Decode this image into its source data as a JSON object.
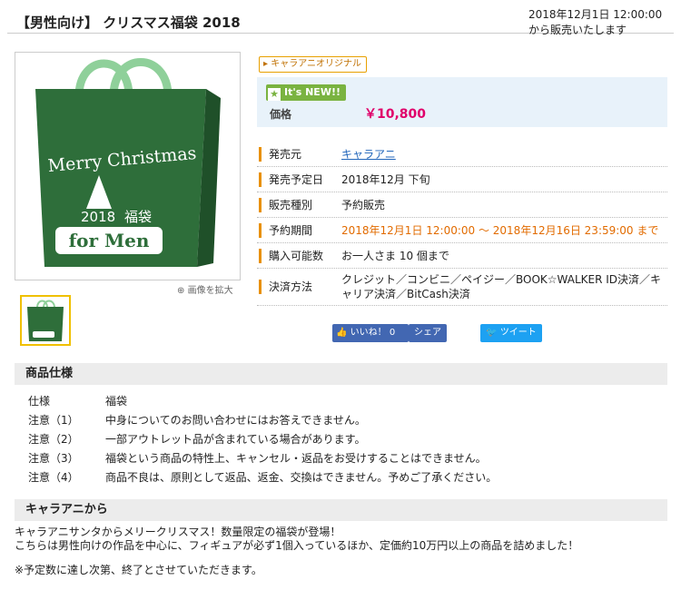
{
  "header": {
    "title": "【男性向け】 クリスマス福袋 2018",
    "release_line1": "2018年12月1日 12:00:00",
    "release_line2": "から販売いたします"
  },
  "image": {
    "bag_text1": "Merry Christmas",
    "bag_year": "2018",
    "bag_kanji": "福袋",
    "bag_label": "for Men",
    "zoom_label": "画像を拡大"
  },
  "badges": {
    "original": "キャラアニオリジナル",
    "new": "It's NEW!!"
  },
  "price": {
    "label": "価格",
    "value": "￥10,800"
  },
  "specs": [
    {
      "label": "発売元",
      "value": "キャラアニ"
    },
    {
      "label": "発売予定日",
      "value": "2018年12月 下旬"
    },
    {
      "label": "販売種別",
      "value": "予約販売"
    },
    {
      "label": "予約期間",
      "value": "2018年12月1日 12:00:00 ～ 2018年12月16日 23:59:00 まで"
    },
    {
      "label": "購入可能数",
      "value": "お一人さま 10 個まで"
    },
    {
      "label": "決済方法",
      "value": "クレジット／コンビニ／ペイジー／BOOK☆WALKER ID決済／キャリア決済／BitCash決済"
    }
  ],
  "social": {
    "like": "いいね！",
    "like_count": "0",
    "share": "シェア",
    "tweet": "ツイート"
  },
  "section1": {
    "title": "商品仕様",
    "rows": [
      {
        "k": "仕様",
        "v": "福袋"
      },
      {
        "k": "注意（1）",
        "v": "中身についてのお問い合わせにはお答えできません。"
      },
      {
        "k": "注意（2）",
        "v": "一部アウトレット品が含まれている場合があります。"
      },
      {
        "k": "注意（3）",
        "v": "福袋という商品の特性上、キャンセル・返品をお受けすることはできません。"
      },
      {
        "k": "注意（4）",
        "v": "商品不良は、原則として返品、返金、交換はできません。予めご了承ください。"
      }
    ]
  },
  "section2": {
    "title": "キャラアニから",
    "line1": "キャラアニサンタからメリークリスマス！数量限定の福袋が登場！",
    "line2": "こちらは男性向けの作品を中心に、フィギュアが必ず1個入っているほか、定価約10万円以上の商品を詰めました！",
    "note": "※予定数に達し次第、終了とさせていただきます。"
  },
  "colors": {
    "bag_green": "#2e6e3a",
    "price": "#e0006a",
    "accent": "#e89000"
  }
}
